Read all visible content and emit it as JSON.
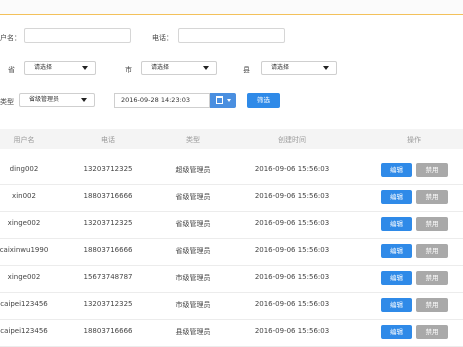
{
  "filters": {
    "user_label": "户名：",
    "phone_label": "电话：",
    "province_label": "省",
    "city_label": "市",
    "county_label": "县",
    "type_label": "类型",
    "province_value": "请选择",
    "city_value": "请选择",
    "county_value": "请选择",
    "type_value": "省级管理员",
    "date_value": "2016-09-28 14:23:03",
    "filter_button": "筛选"
  },
  "table": {
    "headers": [
      "用户名",
      "电话",
      "类型",
      "创建时间",
      "操作"
    ],
    "edit_label": "编辑",
    "disable_label": "禁用",
    "rows": [
      {
        "user": "ding002",
        "phone": "13203712325",
        "type": "超级管理员",
        "created": "2016-09-06 15:56:03"
      },
      {
        "user": "xin002",
        "phone": "18803716666",
        "type": "省级管理员",
        "created": "2016-09-06 15:56:03"
      },
      {
        "user": "xinge002",
        "phone": "13203712325",
        "type": "省级管理员",
        "created": "2016-09-06 15:56:03"
      },
      {
        "user": "caixinwu1990",
        "phone": "18803716666",
        "type": "省级管理员",
        "created": "2016-09-06 15:56:03"
      },
      {
        "user": "xinge002",
        "phone": "15673748787",
        "type": "市级管理员",
        "created": "2016-09-06 15:56:03"
      },
      {
        "user": "caipei123456",
        "phone": "13203712325",
        "type": "市级管理员",
        "created": "2016-09-06 15:56:03"
      },
      {
        "user": "caipei123456",
        "phone": "18803716666",
        "type": "县级管理员",
        "created": "2016-09-06 15:56:03"
      }
    ]
  }
}
